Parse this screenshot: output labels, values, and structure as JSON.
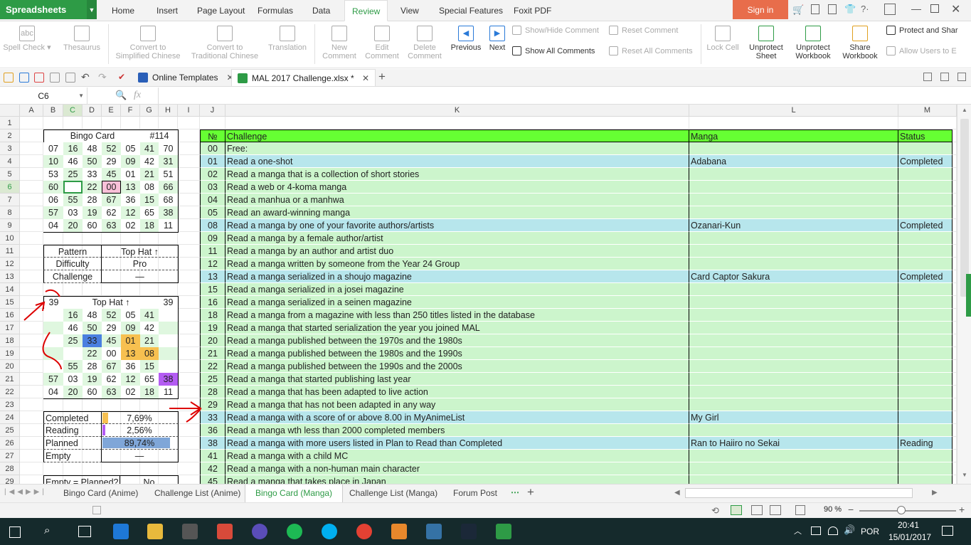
{
  "app": {
    "name": "Spreadsheets",
    "signin": "Sign in"
  },
  "menu": [
    "Home",
    "Insert",
    "Page Layout",
    "Formulas",
    "Data",
    "Review",
    "View",
    "Special Features",
    "Foxit PDF"
  ],
  "ribbon": {
    "spell": "Spell Check",
    "thesaurus": "Thesaurus",
    "trad1": "Convert to",
    "trad2": "Simplified Chinese",
    "simp1": "Convert to",
    "simp2": "Traditional Chinese",
    "translation": "Translation",
    "new1": "New",
    "new2": "Comment",
    "edit1": "Edit",
    "edit2": "Comment",
    "del1": "Delete",
    "del2": "Comment",
    "previous": "Previous",
    "next": "Next",
    "showhide": "Show/Hide Comment",
    "showall": "Show All Comments",
    "reset": "Reset Comment",
    "resetall": "Reset All Comments",
    "lockcell": "Lock Cell",
    "upsheet1": "Unprotect",
    "upsheet2": "Sheet",
    "upwb1": "Unprotect",
    "upwb2": "Workbook",
    "share1": "Share",
    "share2": "Workbook",
    "protect": "Protect and Shar",
    "allow": "Allow Users to E"
  },
  "doctabs": {
    "templates": "Online Templates",
    "file": "MAL 2017 Challenge.xlsx *"
  },
  "formula": {
    "namebox": "C6",
    "fx": "fx"
  },
  "columns": [
    "A",
    "B",
    "C",
    "D",
    "E",
    "F",
    "G",
    "H",
    "I",
    "J",
    "K",
    "L",
    "M"
  ],
  "rows": [
    "1",
    "2",
    "3",
    "4",
    "5",
    "6",
    "7",
    "8",
    "9",
    "10",
    "11",
    "12",
    "13",
    "14",
    "15",
    "16",
    "17",
    "18",
    "19",
    "20",
    "21",
    "22",
    "23",
    "24",
    "25",
    "26",
    "27",
    "28",
    "29"
  ],
  "bingo": {
    "title": "Bingo Card",
    "num": "#114",
    "grid": [
      [
        "07",
        "16",
        "48",
        "52",
        "05",
        "41",
        "70"
      ],
      [
        "10",
        "46",
        "50",
        "29",
        "09",
        "42",
        "31"
      ],
      [
        "53",
        "25",
        "33",
        "45",
        "01",
        "21",
        "51"
      ],
      [
        "60",
        "",
        "22",
        "00",
        "13",
        "08",
        "66"
      ],
      [
        "06",
        "55",
        "28",
        "67",
        "36",
        "15",
        "68"
      ],
      [
        "57",
        "03",
        "19",
        "62",
        "12",
        "65",
        "38"
      ],
      [
        "04",
        "20",
        "60",
        "63",
        "02",
        "18",
        "11"
      ]
    ]
  },
  "pattern": {
    "l1": "Pattern",
    "v1": "Top Hat ↑",
    "l2": "Difficulty",
    "v2": "Pro",
    "l3": "Challenge",
    "v3": "—"
  },
  "tophat": {
    "left": "39",
    "title": "Top Hat ↑",
    "right": "39",
    "grid": [
      [
        "",
        "16",
        "48",
        "52",
        "05",
        "41",
        ""
      ],
      [
        "",
        "46",
        "50",
        "29",
        "09",
        "42",
        ""
      ],
      [
        "",
        "25",
        "33",
        "45",
        "01",
        "21",
        ""
      ],
      [
        "",
        "",
        "22",
        "00",
        "13",
        "08",
        ""
      ],
      [
        "",
        "55",
        "28",
        "67",
        "36",
        "15",
        ""
      ],
      [
        "57",
        "03",
        "19",
        "62",
        "12",
        "65",
        "38"
      ],
      [
        "04",
        "20",
        "60",
        "63",
        "02",
        "18",
        "11"
      ]
    ]
  },
  "stats": [
    {
      "label": "Completed",
      "value": "7,69%",
      "fill": 0.0769
    },
    {
      "label": "Reading",
      "value": "2,56%",
      "fill": 0.0256
    },
    {
      "label": "Planned",
      "value": "89,74%",
      "fill": 0.8974
    },
    {
      "label": "Empty",
      "value": "—",
      "fill": 0
    }
  ],
  "stat_last": {
    "label": "Empty = Planned?",
    "value": "No"
  },
  "table": {
    "headers": [
      "№",
      "Challenge",
      "Manga",
      "Status"
    ],
    "rows": [
      [
        "00",
        "Free:",
        "",
        ""
      ],
      [
        "01",
        "Read a one-shot",
        "Adabana",
        "Completed"
      ],
      [
        "02",
        "Read a manga that is a collection of short stories",
        "",
        ""
      ],
      [
        "03",
        "Read a web or 4-koma manga",
        "",
        ""
      ],
      [
        "04",
        "Read a manhua or a manhwa",
        "",
        ""
      ],
      [
        "05",
        "Read an award-winning manga",
        "",
        ""
      ],
      [
        "08",
        "Read a manga by one of your favorite authors/artists",
        "Ozanari-Kun",
        "Completed"
      ],
      [
        "09",
        "Read a manga by a female author/artist",
        "",
        ""
      ],
      [
        "11",
        "Read a manga by an author and artist duo",
        "",
        ""
      ],
      [
        "12",
        "Read a manga written by someone from the Year 24 Group",
        "",
        ""
      ],
      [
        "13",
        "Read a manga serialized in a shoujo magazine",
        "Card Captor Sakura",
        "Completed"
      ],
      [
        "15",
        "Read a manga serialized in a josei magazine",
        "",
        ""
      ],
      [
        "16",
        "Read a manga serialized in a seinen magazine",
        "",
        ""
      ],
      [
        "18",
        "Read a manga from a magazine with less than 250 titles listed in the database",
        "",
        ""
      ],
      [
        "19",
        "Read a manga that started serialization the year you joined MAL",
        "",
        ""
      ],
      [
        "20",
        "Read a manga published between the 1970s and the 1980s",
        "",
        ""
      ],
      [
        "21",
        "Read a manga published between the 1980s and the 1990s",
        "",
        ""
      ],
      [
        "22",
        "Read a manga published between the 1990s and the 2000s",
        "",
        ""
      ],
      [
        "25",
        "Read a manga that started publishing last year",
        "",
        ""
      ],
      [
        "28",
        "Read a manga that has been adapted to live action",
        "",
        ""
      ],
      [
        "29",
        "Read a manga that has not been adapted in any way",
        "",
        ""
      ],
      [
        "33",
        "Read a manga with a score of or above 8.00 in MyAnimeList",
        "My Girl",
        ""
      ],
      [
        "36",
        "Read a manga wth less than 2000 completed members",
        "",
        ""
      ],
      [
        "38",
        "Read a manga with more users listed in Plan to Read than Completed",
        "Ran to Haiiro no Sekai",
        "Reading"
      ],
      [
        "41",
        "Read a manga with a child MC",
        "",
        ""
      ],
      [
        "42",
        "Read a manga with a non-human main character",
        "",
        ""
      ],
      [
        "45",
        "Read a manga that takes place in Japan",
        "",
        ""
      ]
    ]
  },
  "sheets": [
    "Bingo Card (Anime)",
    "Challenge List (Anime)",
    "Bingo Card (Manga)",
    "Challenge List (Manga)",
    "Forum Post"
  ],
  "status": {
    "zoom": "90 %"
  },
  "taskbar": {
    "lang": "POR",
    "time": "20:41",
    "date": "15/01/2017"
  },
  "colors": {
    "green": "#2e9b46",
    "headerGreen": "#66ff33",
    "rowGreen": "#ccf5cc",
    "rowCyan": "#b7e6ec",
    "pink": "#f9c0d8",
    "blue": "#4a7fe0",
    "orange": "#f7c050",
    "purple": "#b45cf3"
  }
}
